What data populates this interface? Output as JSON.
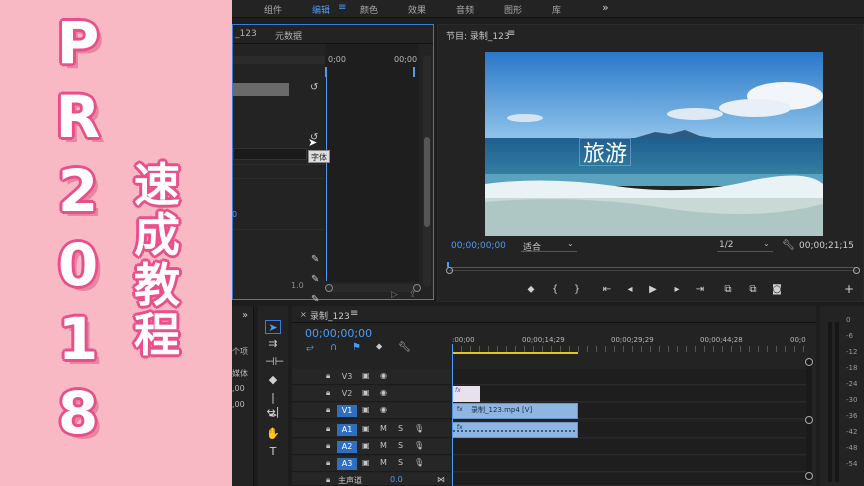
{
  "banner": {
    "pr_chars": [
      "P",
      "R",
      "2",
      "0",
      "1",
      "8"
    ],
    "cn_chars": [
      "速",
      "成",
      "教",
      "程"
    ]
  },
  "workspace_tabs": [
    {
      "label": "组件",
      "active": false
    },
    {
      "label": "编辑",
      "active": true
    },
    {
      "label": "颜色",
      "active": false
    },
    {
      "label": "效果",
      "active": false
    },
    {
      "label": "音频",
      "active": false
    },
    {
      "label": "图形",
      "active": false
    },
    {
      "label": "库",
      "active": false
    }
  ],
  "effect_controls": {
    "tab_partial": "_123",
    "tab_metadata": "元数据",
    "ruler_start": "0;00",
    "ruler_end": "00;00",
    "tooltip": "字体",
    "value_zero": "0",
    "value_one": "1.0"
  },
  "program_monitor": {
    "title": "节目: 录制_123",
    "video_caption": "旅游",
    "timecode_current": "00;00;00;00",
    "fit_option": "适合",
    "resolution": "1/2",
    "timecode_duration": "00;00;21;15"
  },
  "project_panel": {
    "label_items": "个项",
    "label_media": "媒体",
    "label_00a": ",00",
    "label_00b": ",00"
  },
  "timeline": {
    "sequence_tab": "录制_123",
    "timecode": "00;00;00;00",
    "ruler": [
      ":00;00",
      "00;00;14;29",
      "00;00;29;29",
      "00;00;44;28",
      "00;0"
    ],
    "tracks": [
      {
        "name": "V3"
      },
      {
        "name": "V2"
      },
      {
        "name": "V1"
      },
      {
        "name": "A1"
      },
      {
        "name": "A2"
      },
      {
        "name": "A3"
      }
    ],
    "track_m": "M",
    "track_s": "S",
    "master_label": "主声道",
    "master_value": "0.0",
    "clip_title": "fx",
    "clip_video": "录制_123.mp4 [V]",
    "clip_audio": "fx"
  },
  "meters": {
    "db_labels": [
      "0",
      "-6",
      "-12",
      "-18",
      "-24",
      "-30",
      "-36",
      "-42",
      "-48",
      "-54"
    ]
  },
  "colors": {
    "banner_bg": "#f9b9c4",
    "banner_outline": "#e8508a",
    "accent_blue": "#4e9bf6",
    "panel_bg": "#232323",
    "clip_video": "#8fb6e3"
  }
}
